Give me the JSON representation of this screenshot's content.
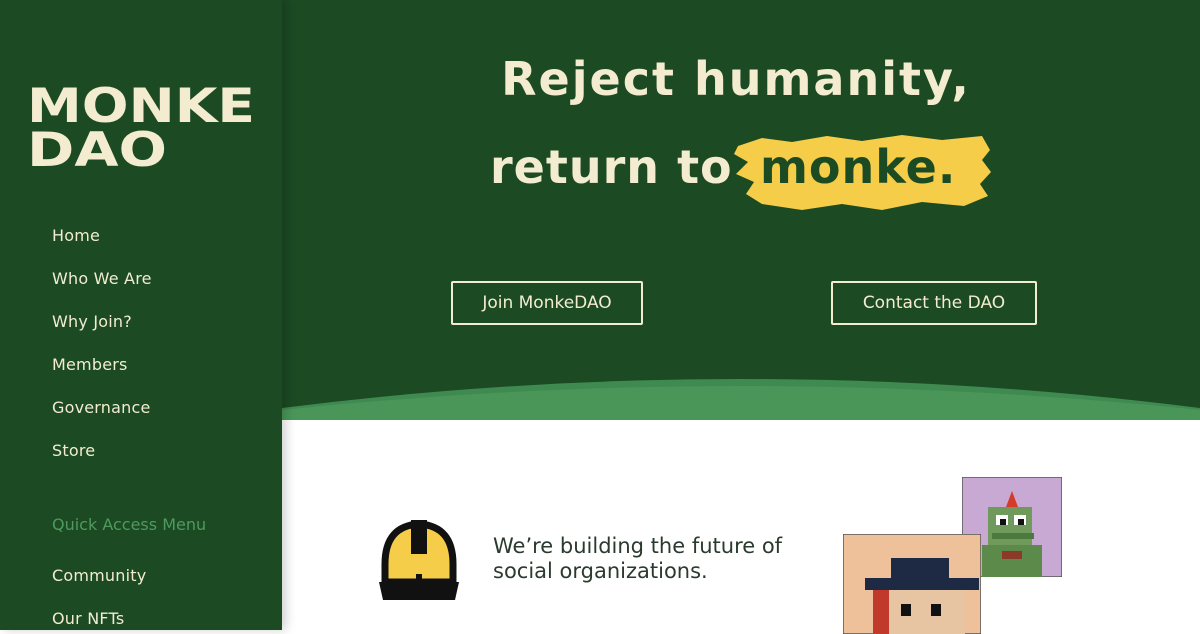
{
  "brand": {
    "logo_text": "MONKE DAO",
    "colors": {
      "primary_green": "#1b4a23",
      "cream": "#f3ecd0",
      "accent_yellow": "#f6cd48",
      "light_green": "#4f9a5f"
    }
  },
  "sidebar": {
    "nav_items": [
      {
        "label": "Home"
      },
      {
        "label": "Who We Are"
      },
      {
        "label": "Why Join?"
      },
      {
        "label": "Members"
      },
      {
        "label": "Governance"
      },
      {
        "label": "Store"
      }
    ],
    "quick_access": {
      "title": "Quick Access Menu",
      "items": [
        {
          "label": "Community"
        },
        {
          "label": "Our NFTs"
        }
      ]
    }
  },
  "hero": {
    "headline_line1": "Reject humanity,",
    "headline_line2_prefix": "return to",
    "headline_line2_highlight": "monke.",
    "buttons": {
      "join": "Join MonkeDAO",
      "contact": "Contact the DAO"
    }
  },
  "content": {
    "tagline": "We’re building the future of social organizations.",
    "icons": {
      "helmet": "hard-hat-icon",
      "nft_1": "pixel-monke-hat-avatar",
      "nft_2": "pixel-dino-avatar"
    }
  }
}
